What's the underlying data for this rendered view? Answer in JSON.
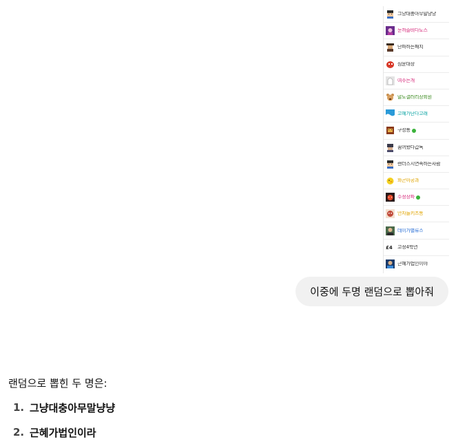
{
  "user_list": [
    {
      "nick": "그냥대충아무말냥냥",
      "color": "#333333",
      "avatar": "pixel-boy-icon"
    },
    {
      "nick": "눈까즐비다도스",
      "color": "#d6287a",
      "avatar": "purple-mage-icon"
    },
    {
      "nick": "단파하는패치",
      "color": "#333333",
      "avatar": "hat-man-icon"
    },
    {
      "nick": "심윤대장",
      "color": "#333333",
      "avatar": "red-creature-icon"
    },
    {
      "nick": "여주는개",
      "color": "#d6287a",
      "avatar": "white-ghost-icon"
    },
    {
      "nick": "말도갤러리장회원",
      "color": "#3a8a1e",
      "avatar": "bear-icon"
    },
    {
      "nick": "고혜가난다고래",
      "color": "#0aa3a3",
      "avatar": "wave-icon"
    },
    {
      "nick": "구성통",
      "color": "#333333",
      "avatar": "box-face-icon",
      "badge": "#3bb33b"
    },
    {
      "nick": "꿈어왔다갑독",
      "color": "#333333",
      "avatar": "helmet-icon"
    },
    {
      "nick": "랜더스시연속하는사람",
      "color": "#333333",
      "avatar": "pixel-boy-icon"
    },
    {
      "nick": "화곤아공과",
      "color": "#e0a400",
      "avatar": "yellow-chick-icon"
    },
    {
      "nick": "수정장파",
      "color": "#d6287a",
      "avatar": "red-face-icon",
      "badge": "#3bb33b"
    },
    {
      "nick": "안자들키즈통",
      "color": "#e0a400",
      "avatar": "brown-face-icon"
    },
    {
      "nick": "데이가별류스",
      "color": "#2a6fd6",
      "avatar": "portrait-icon"
    },
    {
      "nick": "고정4학년",
      "color": "#333333",
      "avatar": "text-logo-icon"
    },
    {
      "nick": "근혜가법인이야",
      "color": "#333333",
      "avatar": "blue-man-icon"
    }
  ],
  "user_message": "이중에 두명 랜덤으로 뽑아줘",
  "assistant": {
    "intro": "랜덤으로 뽑힌 두 명은:",
    "answers": [
      {
        "num": "1.",
        "name": "그냥대충아무말냥냥"
      },
      {
        "num": "2.",
        "name": "근혜가법인이라"
      }
    ]
  },
  "colors": {
    "bubble_bg": "#f1f1f1",
    "text": "#111111"
  }
}
